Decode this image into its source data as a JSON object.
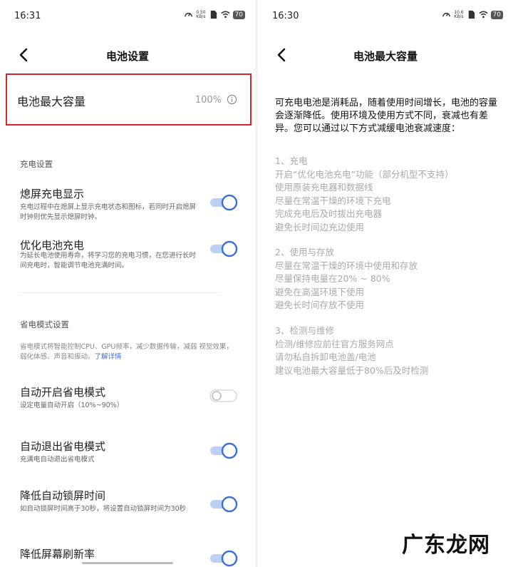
{
  "left": {
    "status": {
      "time": "16:31",
      "speed_top": "0.50",
      "speed_bottom": "KB/s",
      "battery": "70"
    },
    "nav": {
      "title": "电池设置"
    },
    "capacity": {
      "label": "电池最大容量",
      "value": "100%"
    },
    "charging": {
      "header": "充电设置",
      "rows": [
        {
          "title": "熄屏充电显示",
          "desc": "充电过程中在熄屏上显示充电状态和图标，若同时开启熄屏时钟则优先显示熄屏时钟。",
          "on": true
        },
        {
          "title": "优化电池充电",
          "desc": "为延长电池使用寿命，将学习您的充电习惯，在您进行长时间充电时，智能调节电池充满时间。",
          "on": true
        }
      ]
    },
    "power_saving": {
      "header": "省电模式设置",
      "desc": "省电模式将智能控制CPU、GPU频率，减少数据传输，减弱 视觉效果，弱化体感、声音和振动。",
      "link": "了解详情",
      "rows": [
        {
          "title": "自动开启省电模式",
          "desc": "设定电量自动开启（10%~90%）",
          "on": false
        },
        {
          "title": "自动退出省电模式",
          "desc": "充满电自动退出省电模式",
          "on": true
        },
        {
          "title": "降低自动锁屏时间",
          "desc": "如自动锁屏时间高于30秒，将设置自动锁屏时间为30秒",
          "on": true
        },
        {
          "title": "降低屏幕刷新率",
          "desc": "",
          "on": true
        }
      ]
    }
  },
  "right": {
    "status": {
      "time": "16:30",
      "speed_top": "10.6",
      "speed_bottom": "KB/s",
      "battery": "70"
    },
    "nav": {
      "title": "电池最大容量"
    },
    "intro": "可充电电池是消耗品，随着使用时间增长，电池的容量会逐渐降低。使用环境及使用方式不同，衰减也有差异。您可以通过以下方式减缓电池衰减速度：",
    "sections": [
      {
        "lines": [
          "1、充电",
          "开启“优化电池充电”功能（部分机型不支持）",
          "使用原装充电器和数据线",
          "尽量在常温干燥的环境下充电",
          "完成充电后及时拔出充电器",
          "避免长时间边充边使用"
        ]
      },
      {
        "lines": [
          "2、使用与存放",
          "尽量在常温干燥的环境中使用和存放",
          "尽量保持电量在20% ~ 80%",
          "避免在高温环境下使用",
          "避免长时间存放不使用"
        ]
      },
      {
        "lines": [
          "3、检测与维修",
          "检测/维修应前往官方服务网点",
          "请勿私自拆卸电池盖/电池",
          "建议电池最大容量低于80%后及时检测"
        ]
      }
    ]
  },
  "watermark": "广东龙网",
  "colors": {
    "accent": "#3a6fd8",
    "highlight_border": "#d9232e",
    "toggle_track": "#bcd0f5",
    "toggle_off": "#d8d8d8"
  }
}
